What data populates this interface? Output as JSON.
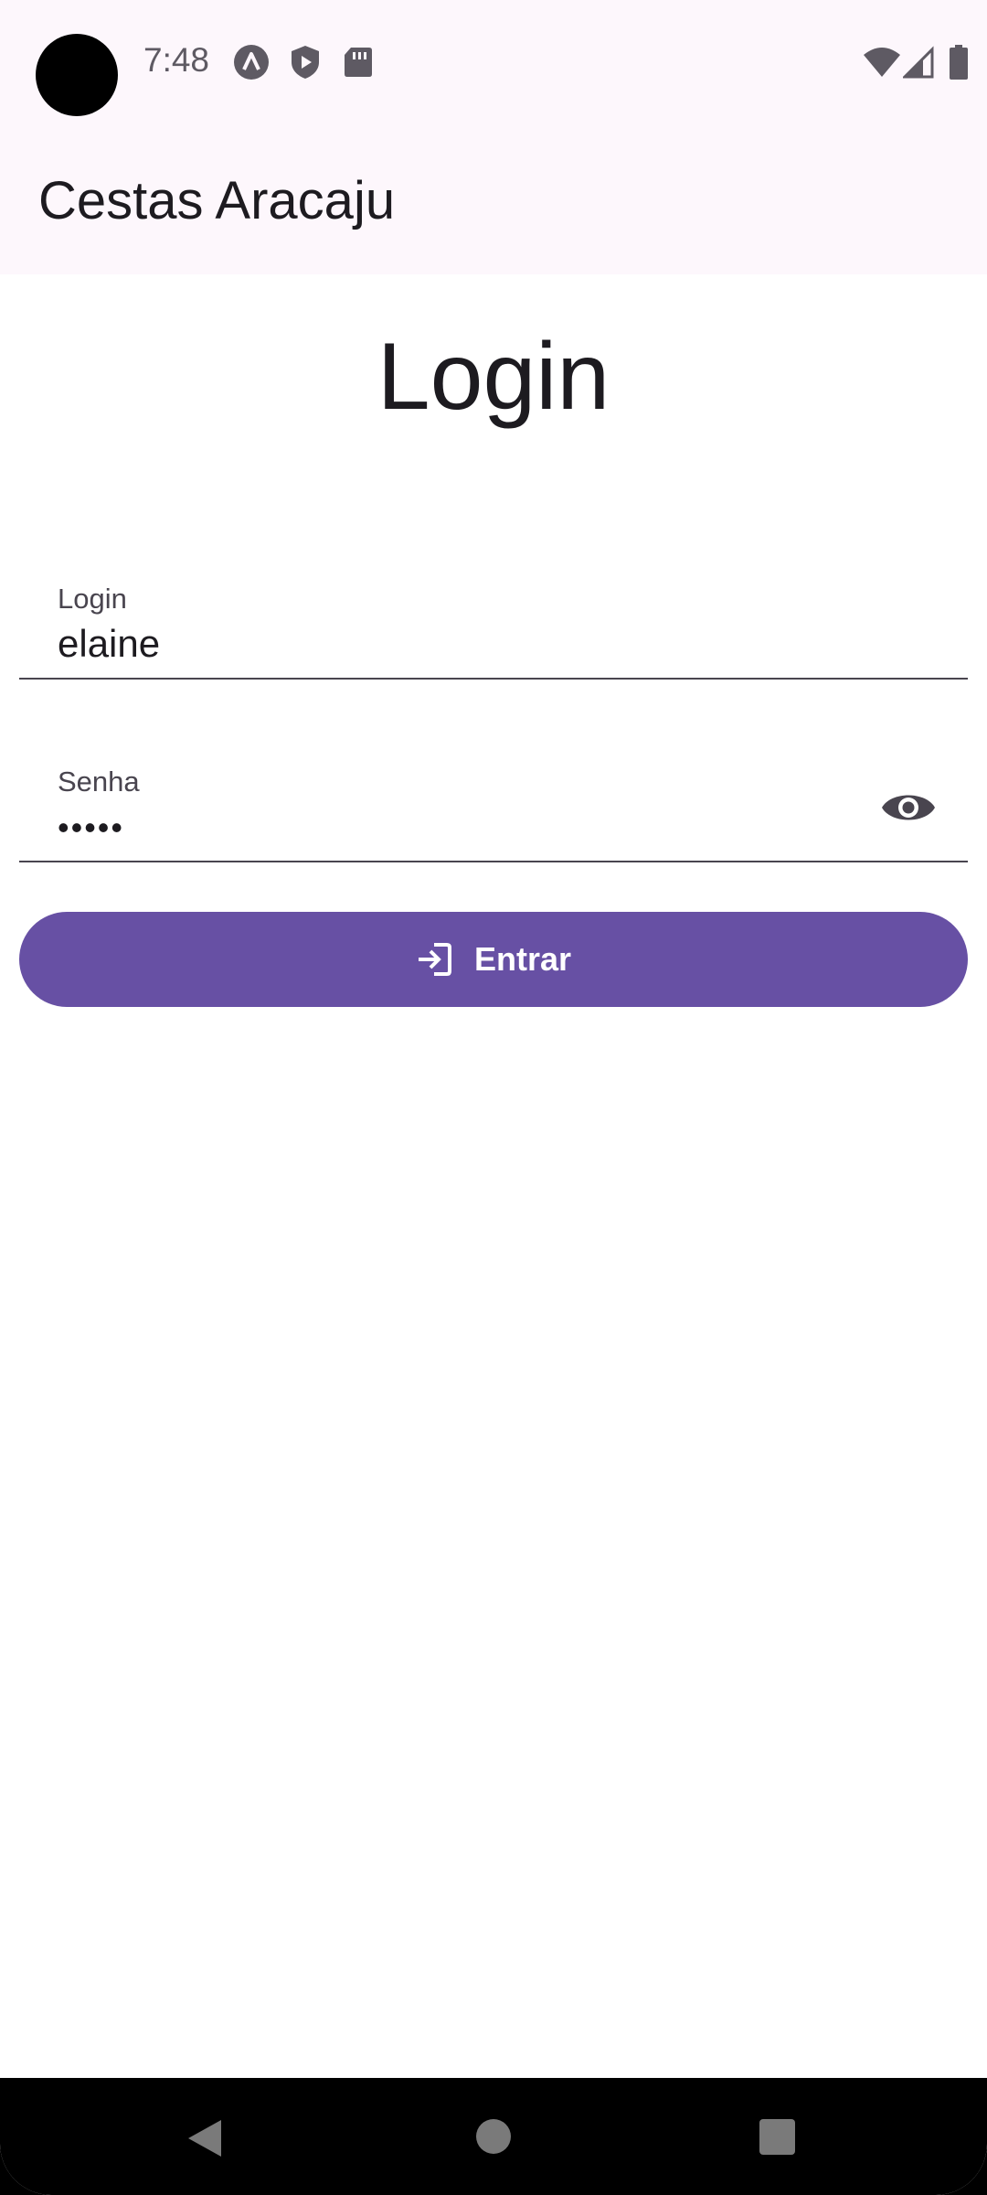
{
  "status_bar": {
    "time": "7:48",
    "left_icons": [
      "app-notification-icon",
      "play-protect-icon",
      "sd-card-icon"
    ],
    "right_icons": [
      "wifi-icon",
      "signal-icon",
      "battery-icon"
    ]
  },
  "app_bar": {
    "title": "Cestas Aracaju"
  },
  "form": {
    "heading": "Login",
    "login_field": {
      "label": "Login",
      "value": "elaine"
    },
    "password_field": {
      "label": "Senha",
      "masked_value": "•••••",
      "visibility_icon": "eye-icon"
    },
    "submit": {
      "label": "Entrar",
      "icon": "login-icon"
    }
  },
  "nav_bar": {
    "buttons": [
      "back",
      "home",
      "recents"
    ]
  },
  "colors": {
    "primary": "#6750a4",
    "top_bar_background": "#fdf7fc",
    "text": "#1d1b20",
    "muted_text": "#49454f"
  }
}
